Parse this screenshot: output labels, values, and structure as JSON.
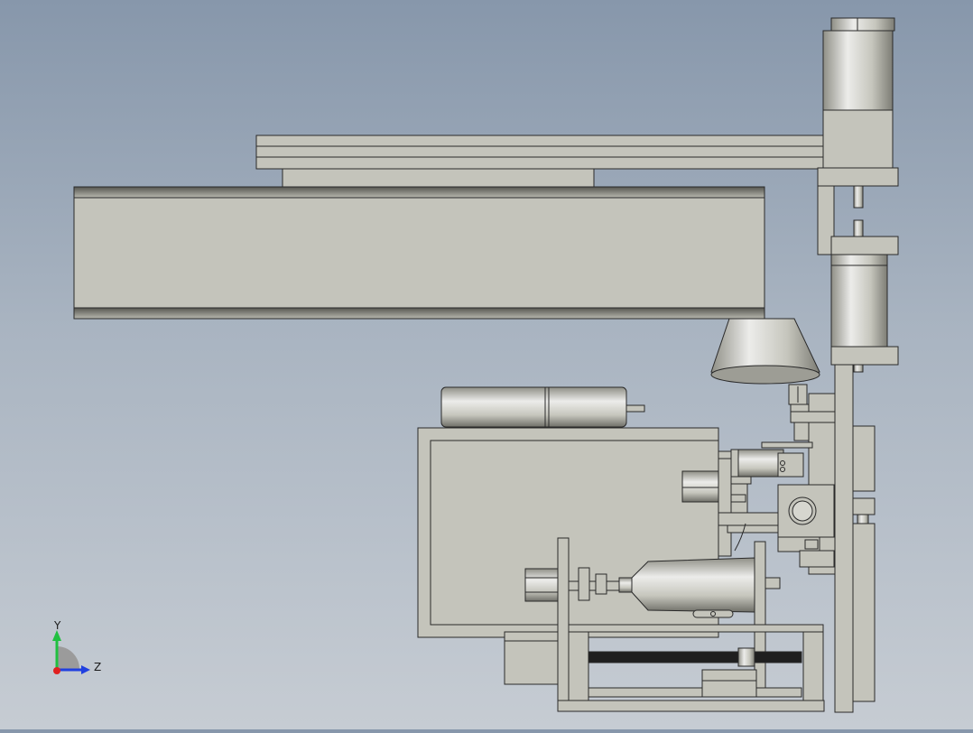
{
  "viewport": {
    "background_top": "#8797ab",
    "background_bottom": "#c6ccd3",
    "model_color": "#c4c4bb",
    "edge_color": "#2a2a2a"
  },
  "triad": {
    "y_label": "Y",
    "z_label": "Z",
    "y_color": "#20c040",
    "z_color": "#2040e0",
    "origin_color": "#e02020"
  }
}
